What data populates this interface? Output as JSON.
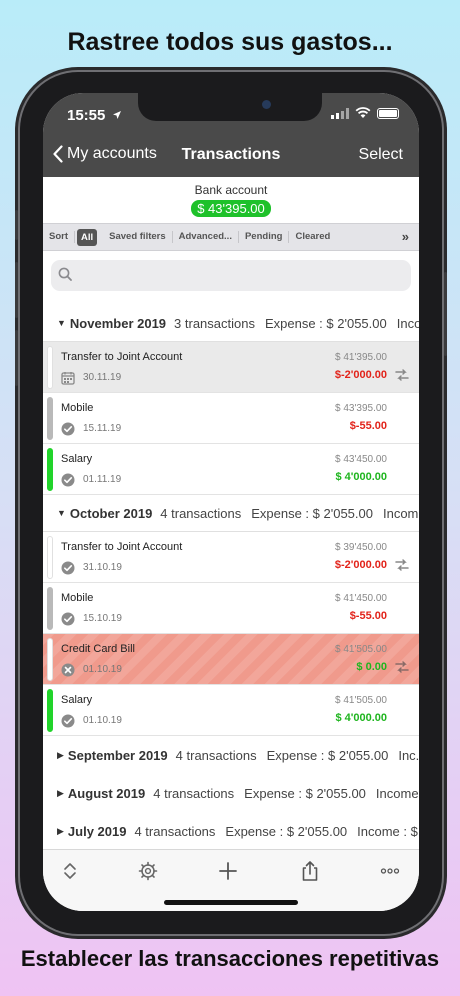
{
  "headline_top": "Rastree todos sus gastos...",
  "headline_bottom": "Establecer las transacciones repetitivas",
  "status_bar": {
    "time": "15:55"
  },
  "nav": {
    "back_label": "My accounts",
    "title": "Transactions",
    "action_label": "Select"
  },
  "account": {
    "name": "Bank account",
    "balance": "$ 43'395.00"
  },
  "filters": {
    "sort": "Sort",
    "all": "All",
    "saved": "Saved filters",
    "advanced": "Advanced...",
    "pending": "Pending",
    "cleared": "Cleared",
    "more": "»"
  },
  "search": {
    "placeholder": ""
  },
  "months": [
    {
      "name": "November 2019",
      "count": "3 transactions",
      "expense": "Expense : $ 2'055.00",
      "income": "Inco...",
      "transactions": [
        {
          "name": "Transfer to Joint Account",
          "date": "30.11.19",
          "balance": "$ 41'395.00",
          "amount": "$-2'000.00"
        },
        {
          "name": "Mobile",
          "date": "15.11.19",
          "balance": "$ 43'395.00",
          "amount": "$-55.00"
        },
        {
          "name": "Salary",
          "date": "01.11.19",
          "balance": "$ 43'450.00",
          "amount": "$ 4'000.00"
        }
      ]
    },
    {
      "name": "October 2019",
      "count": "4 transactions",
      "expense": "Expense : $ 2'055.00",
      "income": "Incom...",
      "transactions": [
        {
          "name": "Transfer to Joint Account",
          "date": "31.10.19",
          "balance": "$ 39'450.00",
          "amount": "$-2'000.00"
        },
        {
          "name": "Mobile",
          "date": "15.10.19",
          "balance": "$ 41'450.00",
          "amount": "$-55.00"
        },
        {
          "name": "Credit Card Bill",
          "date": "01.10.19",
          "balance": "$ 41'505.00",
          "amount": "$ 0.00"
        },
        {
          "name": "Salary",
          "date": "01.10.19",
          "balance": "$ 41'505.00",
          "amount": "$ 4'000.00"
        }
      ]
    },
    {
      "name": "September 2019",
      "count": "4 transactions",
      "expense": "Expense : $ 2'055.00",
      "income": "Inc..."
    },
    {
      "name": "August 2019",
      "count": "4 transactions",
      "expense": "Expense : $ 2'055.00",
      "income": "Income..."
    },
    {
      "name": "July 2019",
      "count": "4 transactions",
      "expense": "Expense : $ 2'055.00",
      "income": "Income : $..."
    }
  ],
  "toolbar_icons": [
    "sort-arrows-icon",
    "gear-icon",
    "plus-icon",
    "share-icon",
    "more-icon"
  ],
  "colors": {
    "nav_bg": "#4a4a4a",
    "balance_badge": "#1ec12a",
    "negative": "#e2231a",
    "positive": "#1fb51f",
    "highlight_red": "#f09a8c"
  }
}
